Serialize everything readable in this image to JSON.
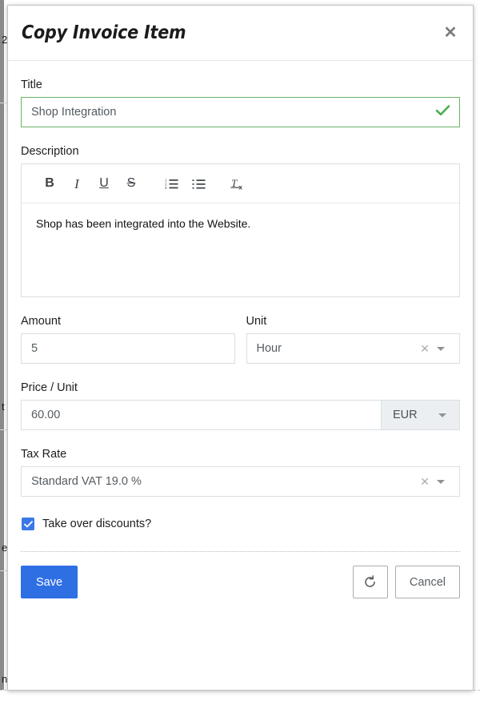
{
  "modal": {
    "title": "Copy Invoice Item",
    "close_icon": "close-icon",
    "fields": {
      "title": {
        "label": "Title",
        "value": "Shop Integration",
        "placeholder": "Title",
        "valid": true,
        "valid_icon": "check-icon",
        "valid_color": "#4caf50"
      },
      "description": {
        "label": "Description",
        "value": "Shop has been integrated into the Website.",
        "toolbar": [
          {
            "name": "bold-icon",
            "label": "B",
            "title": "Bold"
          },
          {
            "name": "italic-icon",
            "label": "I",
            "title": "Italic"
          },
          {
            "name": "underline-icon",
            "label": "U",
            "title": "Underline"
          },
          {
            "name": "strikethrough-icon",
            "label": "S",
            "title": "Strikethrough"
          },
          {
            "name": "ordered-list-icon",
            "label": "",
            "title": "Numbered List"
          },
          {
            "name": "unordered-list-icon",
            "label": "",
            "title": "Bulleted List"
          },
          {
            "name": "remove-format-icon",
            "label": "",
            "title": "Remove Format"
          }
        ]
      },
      "amount": {
        "label": "Amount",
        "value": "5",
        "placeholder": "Amount"
      },
      "unit": {
        "label": "Unit",
        "value": "Hour",
        "clear_icon": "clear-icon",
        "caret_icon": "chevron-down-icon"
      },
      "price_per_unit": {
        "label": "Price / Unit",
        "value": "60.00",
        "placeholder": "Price / Unit",
        "currency": "EUR",
        "currency_caret_icon": "chevron-down-icon"
      },
      "tax_rate": {
        "label": "Tax Rate",
        "value": "Standard VAT 19.0 %",
        "clear_icon": "clear-icon",
        "caret_icon": "chevron-down-icon"
      },
      "take_over_discounts": {
        "label": "Take over discounts?",
        "checked": true,
        "color": "#3b78e7"
      }
    },
    "footer": {
      "save_label": "Save",
      "reset_icon": "undo-icon",
      "cancel_label": "Cancel",
      "save_color": "#2f6fe4"
    }
  },
  "background": {
    "line1": "2",
    "line2": "t",
    "line3": "e",
    "line4": "n"
  }
}
